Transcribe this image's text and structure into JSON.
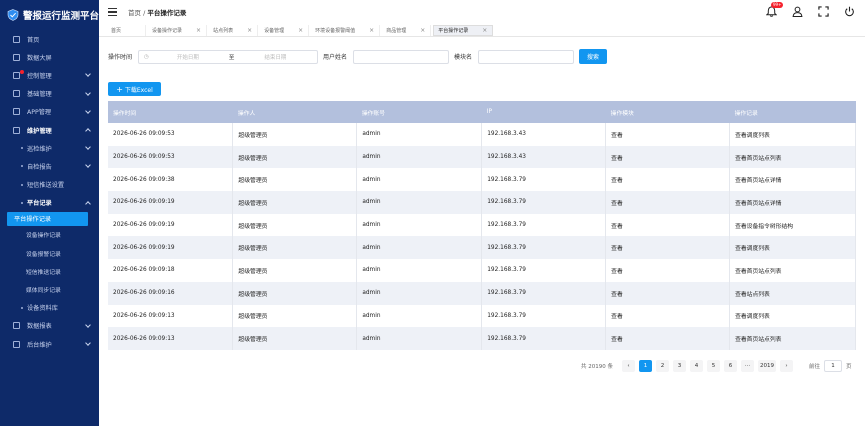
{
  "app": {
    "title": "警报运行监测平台"
  },
  "sidebar": {
    "items": [
      {
        "label": "首页",
        "type": "top"
      },
      {
        "label": "数据大屏",
        "type": "top"
      },
      {
        "label": "控制管理",
        "type": "top",
        "chev": "down",
        "badge": true
      },
      {
        "label": "基础管理",
        "type": "top",
        "chev": "down"
      },
      {
        "label": "APP管理",
        "type": "top",
        "chev": "down"
      },
      {
        "label": "维护管理",
        "type": "open",
        "chev": "up"
      },
      {
        "label": "巡检维护",
        "type": "sub",
        "chev": "down"
      },
      {
        "label": "自检报告",
        "type": "sub",
        "chev": "down"
      },
      {
        "label": "短信推送设置",
        "type": "sub"
      },
      {
        "label": "平台记录",
        "type": "subopen",
        "chev": "up"
      },
      {
        "label": "平台操作记录",
        "type": "active"
      },
      {
        "label": "设备操作记录",
        "type": "sub2"
      },
      {
        "label": "设备报警记录",
        "type": "sub2"
      },
      {
        "label": "短信推送记录",
        "type": "sub2"
      },
      {
        "label": "媒体同步记录",
        "type": "sub2"
      },
      {
        "label": "设备资料库",
        "type": "sub"
      },
      {
        "label": "数据报表",
        "type": "top",
        "chev": "down"
      },
      {
        "label": "后台维护",
        "type": "top",
        "chev": "down"
      }
    ]
  },
  "header": {
    "breadcrumb_home": "首页",
    "breadcrumb_sep": "/",
    "breadcrumb_current": "平台操作记录",
    "notification_count": "99+"
  },
  "tabs": [
    {
      "label": "首页",
      "closable": false
    },
    {
      "label": "设备操作记录",
      "closable": true
    },
    {
      "label": "站点列表",
      "closable": true
    },
    {
      "label": "设备管理",
      "closable": true
    },
    {
      "label": "环境设备报警阈值",
      "closable": true
    },
    {
      "label": "商品管理",
      "closable": true
    },
    {
      "label": "平台操作记录",
      "closable": true,
      "current": true
    }
  ],
  "filter": {
    "op_time_label": "操作时间",
    "start_placeholder": "开始日期",
    "range_sep": "至",
    "end_placeholder": "结束日期",
    "user_label": "用户姓名",
    "module_label": "模块名",
    "search_button": "搜索"
  },
  "toolbar": {
    "download_label": "下载Excel"
  },
  "table": {
    "columns": [
      "操作时间",
      "操作人",
      "操作账号",
      "IP",
      "操作模块",
      "操作记录"
    ],
    "rows": [
      [
        "2026-06-26 09:09:53",
        "超级管理员",
        "admin",
        "192.168.3.43",
        "查看",
        "查看调度列表"
      ],
      [
        "2026-06-26 09:09:53",
        "超级管理员",
        "admin",
        "192.168.3.43",
        "查看",
        "查看首页站点列表"
      ],
      [
        "2026-06-26 09:09:38",
        "超级管理员",
        "admin",
        "192.168.3.79",
        "查看",
        "查看首页站点详情"
      ],
      [
        "2026-06-26 09:09:19",
        "超级管理员",
        "admin",
        "192.168.3.79",
        "查看",
        "查看首页站点详情"
      ],
      [
        "2026-06-26 09:09:19",
        "超级管理员",
        "admin",
        "192.168.3.79",
        "查看",
        "查看设备指令树形结构"
      ],
      [
        "2026-06-26 09:09:19",
        "超级管理员",
        "admin",
        "192.168.3.79",
        "查看",
        "查看调度列表"
      ],
      [
        "2026-06-26 09:09:18",
        "超级管理员",
        "admin",
        "192.168.3.79",
        "查看",
        "查看首页站点列表"
      ],
      [
        "2026-06-26 09:09:16",
        "超级管理员",
        "admin",
        "192.168.3.79",
        "查看",
        "查看站点列表"
      ],
      [
        "2026-06-26 09:09:13",
        "超级管理员",
        "admin",
        "192.168.3.79",
        "查看",
        "查看调度列表"
      ],
      [
        "2026-06-26 09:09:13",
        "超级管理员",
        "admin",
        "192.168.3.79",
        "查看",
        "查看首页站点列表"
      ]
    ]
  },
  "pagination": {
    "total_text": "共 20190 条",
    "prev": "‹",
    "next": "›",
    "pages": [
      "1",
      "2",
      "3",
      "4",
      "5",
      "6",
      "···",
      "2019"
    ],
    "current": "1",
    "goto_label": "前往",
    "goto_value": "1",
    "goto_unit": "页"
  },
  "colors": {
    "sidebar_bg": "#0e2a69",
    "accent": "#1296f0",
    "table_header": "#b3c0dd"
  }
}
